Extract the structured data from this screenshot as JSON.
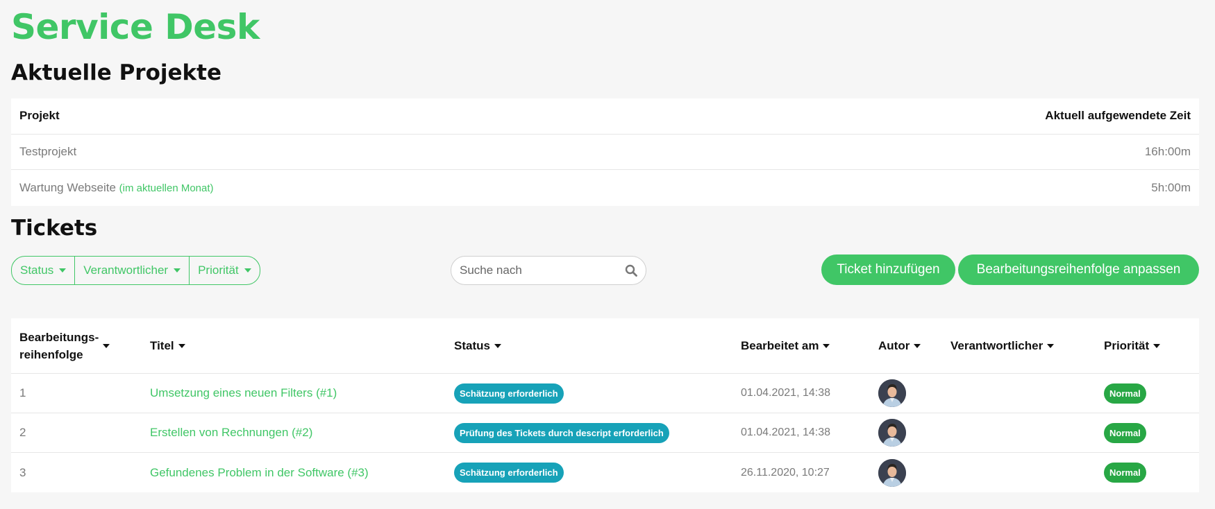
{
  "app_title": "Service Desk",
  "projects": {
    "heading": "Aktuelle Projekte",
    "col_project": "Projekt",
    "col_time": "Aktuell aufgewendete Zeit",
    "rows": [
      {
        "name": "Testprojekt",
        "note": "",
        "time": "16h:00m"
      },
      {
        "name": "Wartung Webseite",
        "note": "(im aktuellen Monat)",
        "time": "5h:00m"
      }
    ]
  },
  "tickets": {
    "heading": "Tickets",
    "filters": {
      "status": "Status",
      "assignee": "Verantwortlicher",
      "priority": "Priorität"
    },
    "search_placeholder": "Suche nach",
    "add_button": "Ticket hinzufügen",
    "order_button": "Bearbeitungsreihenfolge anpassen",
    "columns": {
      "order_line1": "Bearbeitungs-",
      "order_line2": "reihenfolge",
      "title": "Titel",
      "status": "Status",
      "edited": "Bearbeitet am",
      "author": "Autor",
      "assignee": "Verantwortlicher",
      "priority": "Priorität"
    },
    "rows": [
      {
        "order": "1",
        "title": "Umsetzung eines neuen Filters (#1)",
        "status": "Schätzung erforderlich",
        "edited": "01.04.2021, 14:38",
        "assignee": "",
        "priority": "Normal"
      },
      {
        "order": "2",
        "title": "Erstellen von Rechnungen (#2)",
        "status": "Prüfung des Tickets durch descript erforderlich",
        "edited": "01.04.2021, 14:38",
        "assignee": "",
        "priority": "Normal"
      },
      {
        "order": "3",
        "title": "Gefundenes Problem in der Software (#3)",
        "status": "Schätzung erforderlich",
        "edited": "26.11.2020, 10:27",
        "assignee": "",
        "priority": "Normal"
      }
    ]
  },
  "colors": {
    "brand_green": "#40c666",
    "status_teal": "#17a2b8",
    "priority_green": "#28a745"
  }
}
